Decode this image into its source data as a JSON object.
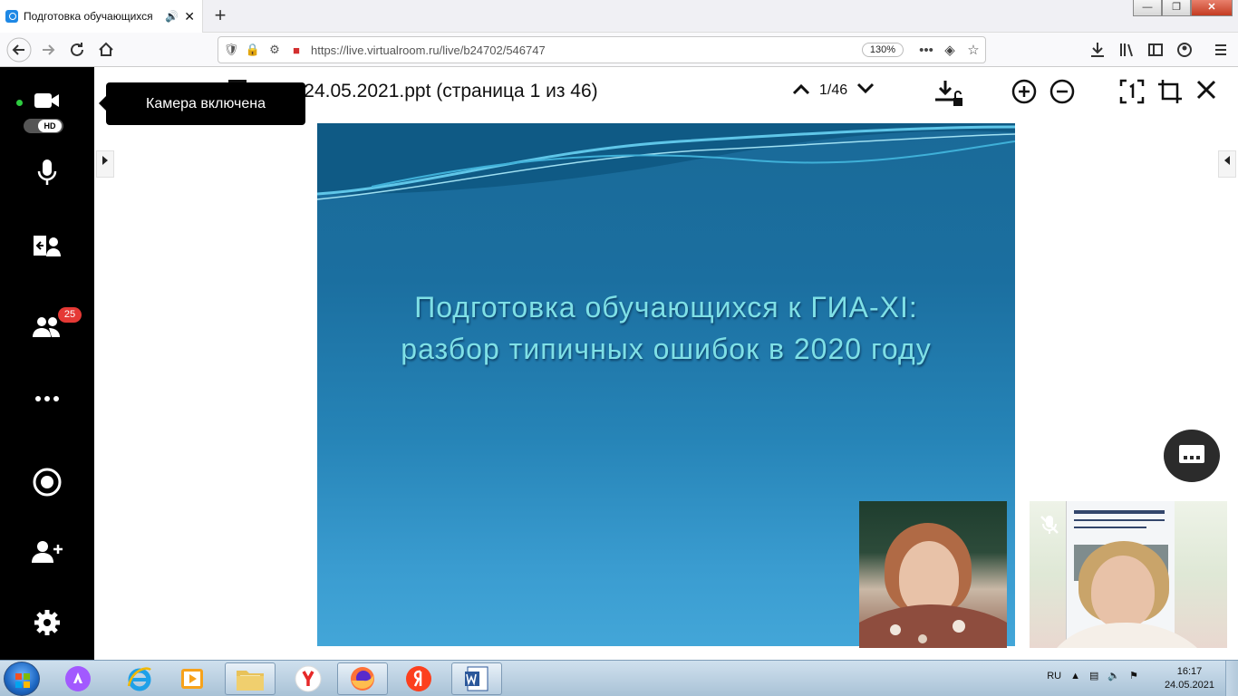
{
  "browser": {
    "tab_title": "Подготовка обучающихся",
    "new_tab": "+",
    "url": "https://live.virtualroom.ru/live/b24702/546747",
    "zoom": "130%",
    "min": "—",
    "max": "❐",
    "close": "✕"
  },
  "sidebar": {
    "participants_count": "25",
    "tooltip": "Камера включена",
    "hd_label": "HD"
  },
  "viewer": {
    "title": "икова 24.05.2021.ppt (страница 1 из 46)",
    "page_indicator": "1/46"
  },
  "slide": {
    "line1": "Подготовка обучающихся к ГИА-XI:",
    "line2": "разбор типичных ошибок в 2020 году"
  },
  "taskbar": {
    "language": "RU",
    "time": "16:17",
    "date": "24.05.2021"
  },
  "colors": {
    "sidebar_bg": "#000000",
    "badge": "#e53935",
    "slide_title": "#7fe0e6",
    "slide_bg": "#1b6fa0"
  }
}
